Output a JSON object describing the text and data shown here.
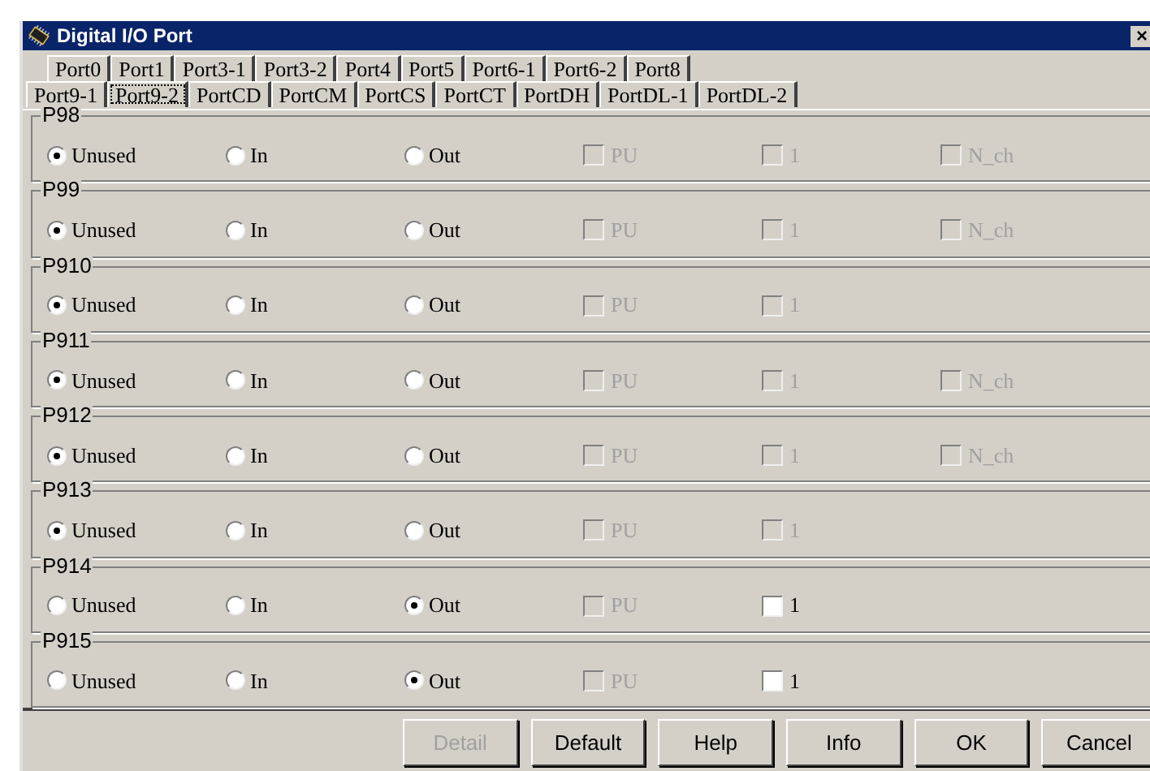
{
  "window": {
    "title": "Digital I/O Port",
    "close": "×"
  },
  "tab_rows": [
    [
      {
        "label": "Port0",
        "selected": false
      },
      {
        "label": "Port1",
        "selected": false
      },
      {
        "label": "Port3-1",
        "selected": false
      },
      {
        "label": "Port3-2",
        "selected": false
      },
      {
        "label": "Port4",
        "selected": false
      },
      {
        "label": "Port5",
        "selected": false
      },
      {
        "label": "Port6-1",
        "selected": false
      },
      {
        "label": "Port6-2",
        "selected": false
      },
      {
        "label": "Port8",
        "selected": false
      }
    ],
    [
      {
        "label": "Port9-1",
        "selected": false
      },
      {
        "label": "Port9-2",
        "selected": true
      },
      {
        "label": "PortCD",
        "selected": false
      },
      {
        "label": "PortCM",
        "selected": false
      },
      {
        "label": "PortCS",
        "selected": false
      },
      {
        "label": "PortCT",
        "selected": false
      },
      {
        "label": "PortDH",
        "selected": false
      },
      {
        "label": "PortDL-1",
        "selected": false
      },
      {
        "label": "PortDL-2",
        "selected": false
      }
    ]
  ],
  "groups": [
    {
      "name": "P98",
      "modes": [
        {
          "label": "Unused",
          "selected": true
        },
        {
          "label": "In",
          "selected": false
        },
        {
          "label": "Out",
          "selected": false
        }
      ],
      "options": [
        {
          "label": "PU",
          "checked": false,
          "disabled": true
        },
        {
          "label": "1",
          "checked": false,
          "disabled": true
        },
        {
          "label": "N_ch",
          "checked": false,
          "disabled": true
        }
      ]
    },
    {
      "name": "P99",
      "modes": [
        {
          "label": "Unused",
          "selected": true
        },
        {
          "label": "In",
          "selected": false
        },
        {
          "label": "Out",
          "selected": false
        }
      ],
      "options": [
        {
          "label": "PU",
          "checked": false,
          "disabled": true
        },
        {
          "label": "1",
          "checked": false,
          "disabled": true
        },
        {
          "label": "N_ch",
          "checked": false,
          "disabled": true
        }
      ]
    },
    {
      "name": "P910",
      "modes": [
        {
          "label": "Unused",
          "selected": true
        },
        {
          "label": "In",
          "selected": false
        },
        {
          "label": "Out",
          "selected": false
        }
      ],
      "options": [
        {
          "label": "PU",
          "checked": false,
          "disabled": true
        },
        {
          "label": "1",
          "checked": false,
          "disabled": true
        }
      ]
    },
    {
      "name": "P911",
      "modes": [
        {
          "label": "Unused",
          "selected": true
        },
        {
          "label": "In",
          "selected": false
        },
        {
          "label": "Out",
          "selected": false
        }
      ],
      "options": [
        {
          "label": "PU",
          "checked": false,
          "disabled": true
        },
        {
          "label": "1",
          "checked": false,
          "disabled": true
        },
        {
          "label": "N_ch",
          "checked": false,
          "disabled": true
        }
      ]
    },
    {
      "name": "P912",
      "modes": [
        {
          "label": "Unused",
          "selected": true
        },
        {
          "label": "In",
          "selected": false
        },
        {
          "label": "Out",
          "selected": false
        }
      ],
      "options": [
        {
          "label": "PU",
          "checked": false,
          "disabled": true
        },
        {
          "label": "1",
          "checked": false,
          "disabled": true
        },
        {
          "label": "N_ch",
          "checked": false,
          "disabled": true
        }
      ]
    },
    {
      "name": "P913",
      "modes": [
        {
          "label": "Unused",
          "selected": true
        },
        {
          "label": "In",
          "selected": false
        },
        {
          "label": "Out",
          "selected": false
        }
      ],
      "options": [
        {
          "label": "PU",
          "checked": false,
          "disabled": true
        },
        {
          "label": "1",
          "checked": false,
          "disabled": true
        }
      ]
    },
    {
      "name": "P914",
      "modes": [
        {
          "label": "Unused",
          "selected": false
        },
        {
          "label": "In",
          "selected": false
        },
        {
          "label": "Out",
          "selected": true
        }
      ],
      "options": [
        {
          "label": "PU",
          "checked": false,
          "disabled": true
        },
        {
          "label": "1",
          "checked": false,
          "disabled": false
        }
      ]
    },
    {
      "name": "P915",
      "modes": [
        {
          "label": "Unused",
          "selected": false
        },
        {
          "label": "In",
          "selected": false
        },
        {
          "label": "Out",
          "selected": true
        }
      ],
      "options": [
        {
          "label": "PU",
          "checked": false,
          "disabled": true
        },
        {
          "label": "1",
          "checked": false,
          "disabled": false
        }
      ]
    }
  ],
  "buttons": [
    {
      "label": "Detail",
      "disabled": true
    },
    {
      "label": "Default",
      "disabled": false
    },
    {
      "label": "Help",
      "disabled": false
    },
    {
      "label": "Info",
      "disabled": false
    },
    {
      "label": "OK",
      "disabled": false
    },
    {
      "label": "Cancel",
      "disabled": false
    }
  ]
}
